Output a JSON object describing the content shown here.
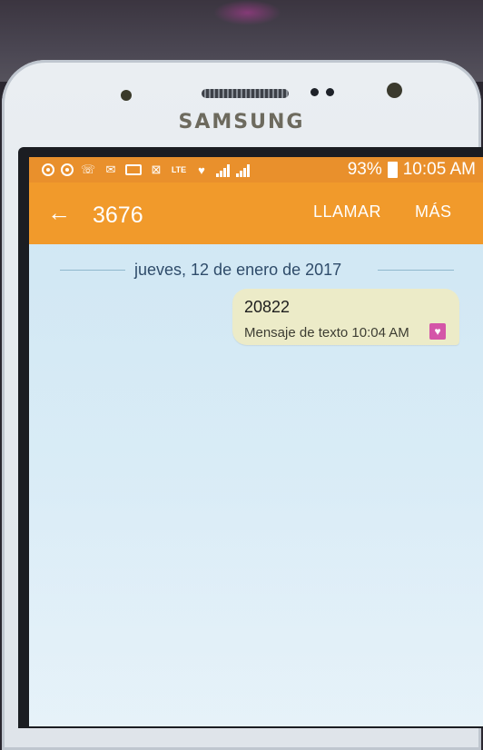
{
  "device": {
    "brand": "SAMSUNG"
  },
  "status_bar": {
    "icons": [
      "target-icon",
      "target-icon",
      "missed-call-icon",
      "email-icon",
      "voicemail-icon",
      "mute-icon",
      "lte-icon",
      "heart-icon",
      "signal-icon",
      "signal-icon"
    ],
    "lte_label": "LTE",
    "battery": "93%",
    "time": "10:05 AM"
  },
  "app_bar": {
    "title": "3676",
    "call_label": "LLAMAR",
    "more_label": "MÁS"
  },
  "conversation": {
    "date": "jueves, 12 de enero de 2017",
    "messages": [
      {
        "text": "20822",
        "meta": "Mensaje de texto 10:04 AM"
      }
    ]
  },
  "colors": {
    "status_bar": "#e9902c",
    "app_bar": "#f19a2b",
    "screen_bg": "#d7ebf6",
    "bubble": "#ecebc8"
  }
}
